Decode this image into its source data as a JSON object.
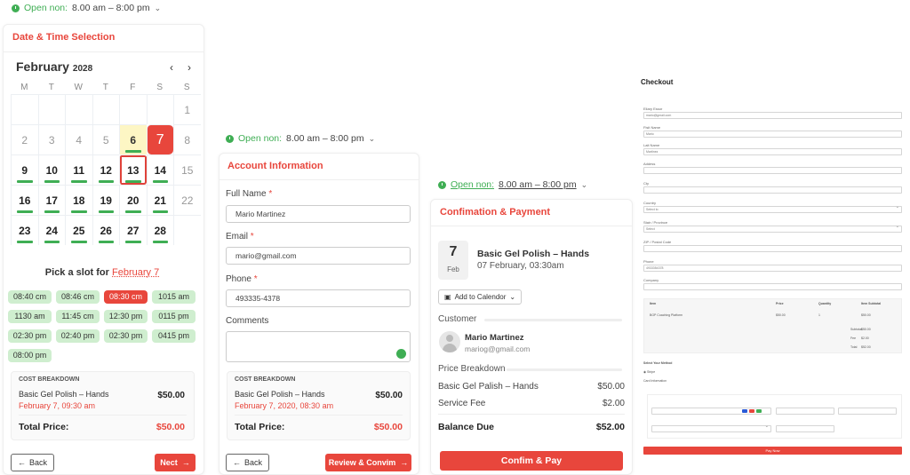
{
  "open_hours": {
    "label": "Open non:",
    "hours": "8.00 am – 8:00 pm"
  },
  "panel1": {
    "title": "Date & Time Selection",
    "calendar": {
      "month": "February",
      "year": "2028",
      "weekdays": [
        "M",
        "T",
        "W",
        "T",
        "F",
        "S",
        "S"
      ],
      "weeks": [
        [
          "",
          "",
          "",
          "",
          "",
          "",
          "1"
        ],
        [
          "2",
          "3",
          "4",
          "5",
          "6",
          "7",
          "8"
        ],
        [
          "9",
          "10",
          "11",
          "12",
          "13",
          "14",
          "15"
        ],
        [
          "16",
          "17",
          "18",
          "19",
          "20",
          "21",
          "22"
        ],
        [
          "23",
          "24",
          "25",
          "26",
          "27",
          "28",
          ""
        ]
      ]
    },
    "pick_prefix": "Pick a slot for",
    "pick_date": "February 7",
    "slots": [
      "08:40 cm",
      "08:46 cm",
      "08:30 cm",
      "1015 am",
      "1130 am",
      "11:45 cm",
      "12:30 pm",
      "0115 pm",
      "02:30 pm",
      "02:40 pm",
      "02:30 pm",
      "0415 pm",
      "08:00 pm"
    ],
    "cost": {
      "header": "COST BREAKDOWN",
      "service": "Basic Gel Polish – Hands",
      "date": "February 7, 09:30 am",
      "amount": "$50.00",
      "total_label": "Total Price:",
      "total": "$50.00"
    },
    "back_label": "Back",
    "next_label": "Nect"
  },
  "panel2": {
    "title": "Account Information",
    "full_name_label": "Full Name",
    "full_name_value": "Mario Martinez",
    "email_label": "Email",
    "email_value": "mario@gmail.com",
    "phone_label": "Phone",
    "phone_value": "493335-4378",
    "comments_label": "Comments",
    "cost": {
      "header": "COST BREAKDOWN",
      "service": "Basic Gel Polish – Hands",
      "date": "February 7, 2020, 08:30 am",
      "amount": "$50.00",
      "total_label": "Total Price:",
      "total": "$50.00"
    },
    "back_label": "Back",
    "review_label": "Review & Convim"
  },
  "panel3": {
    "title": "Confimation & Payment",
    "date_day": "7",
    "date_month": "Feb",
    "service_title": "Basic Gel Polish – Hands",
    "service_date": "07 February, 03:30am",
    "add_calendar": "Add to Calendor",
    "customer_label": "Customer",
    "customer_name": "Mario Martinez",
    "customer_email": "mariog@gmail.com",
    "price_label": "Price Breakdown",
    "items": [
      {
        "name": "Basic Gel Palish – Hands",
        "amount": "$50.00"
      },
      {
        "name": "Service Fee",
        "amount": "$2.00"
      }
    ],
    "balance_label": "Balance Due",
    "balance": "$52.00",
    "confirm_label": "Confim & Pay"
  },
  "checkout": {
    "title": "Checkout",
    "fields": [
      {
        "label": "Eliary Essor",
        "value": "mario@gmail.com"
      },
      {
        "label": "Fisit Name",
        "value": "Mario"
      },
      {
        "label": "Lait Name",
        "value": "Martinez"
      },
      {
        "label": "Addess",
        "value": ""
      },
      {
        "label": "Cty",
        "value": ""
      },
      {
        "label": "Country",
        "value": "Select to"
      },
      {
        "label": "Stair / Province",
        "value": "Select"
      },
      {
        "label": "ZIP / Postal Code",
        "value": ""
      },
      {
        "label": "Phone",
        "value": "4933354378"
      },
      {
        "label": "Company",
        "value": ""
      }
    ],
    "table": {
      "headers": [
        "Item",
        "Price",
        "Quantity",
        "Item Subtotal"
      ],
      "row": [
        "BGP Coaching Platform",
        "$50.00",
        "1",
        "$50.00"
      ],
      "totals": [
        {
          "label": "Subtotal",
          "value": "$50.00"
        },
        {
          "label": "Fee",
          "value": "$2.00"
        },
        {
          "label": "Total",
          "value": "$52.00"
        }
      ]
    },
    "payment_label": "Select Your Method",
    "pay_option": "Stripe",
    "card_label": "Card Information",
    "button_label": "Pay Now"
  }
}
